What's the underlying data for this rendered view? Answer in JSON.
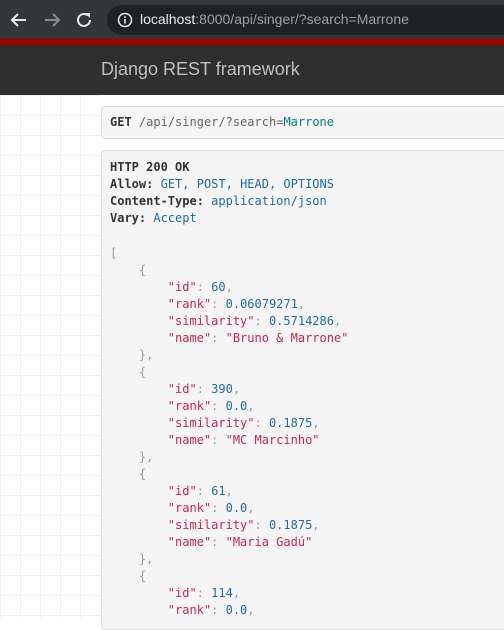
{
  "browser": {
    "url_host": "localhost",
    "url_rest": ":8000/api/singer/?search=Marrone"
  },
  "navbar": {
    "brand": "Django REST framework"
  },
  "request": {
    "method": "GET",
    "path": "/api/singer/",
    "query_mark": "?",
    "query_key": "search=",
    "query_value": "Marrone"
  },
  "response": {
    "status": "HTTP 200 OK",
    "headers": [
      {
        "key": "Allow:",
        "value": "GET, POST, HEAD, OPTIONS"
      },
      {
        "key": "Content-Type:",
        "value": "application/json"
      },
      {
        "key": "Vary:",
        "value": "Accept"
      }
    ],
    "results": [
      {
        "id": "60",
        "rank": "0.06079271",
        "similarity": "0.5714286",
        "name": "\"Bruno & Marrone\""
      },
      {
        "id": "390",
        "rank": "0.0",
        "similarity": "0.1875",
        "name": "\"MC Marcinho\""
      },
      {
        "id": "61",
        "rank": "0.0",
        "similarity": "0.1875",
        "name": "\"Maria Gadú\""
      },
      {
        "id": "114",
        "rank": "0.0"
      }
    ],
    "field_names": {
      "id": "\"id\"",
      "rank": "\"rank\"",
      "similarity": "\"similarity\"",
      "name": "\"name\""
    }
  }
}
